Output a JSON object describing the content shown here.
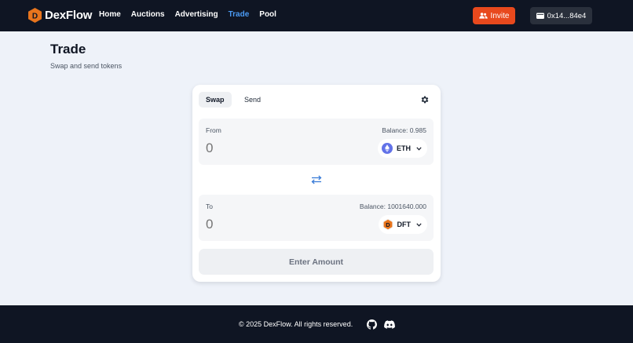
{
  "brand": {
    "name": "DexFlow",
    "logo_letter": "D"
  },
  "nav": {
    "items": [
      {
        "label": "Home",
        "active": false
      },
      {
        "label": "Auctions",
        "active": false
      },
      {
        "label": "Advertising",
        "active": false
      },
      {
        "label": "Trade",
        "active": true
      },
      {
        "label": "Pool",
        "active": false
      }
    ],
    "invite_label": "Invite",
    "wallet_label": "0x14...84e4"
  },
  "page": {
    "title": "Trade",
    "subtitle": "Swap and send tokens"
  },
  "swap": {
    "tabs": [
      {
        "label": "Swap",
        "active": true
      },
      {
        "label": "Send",
        "active": false
      }
    ],
    "from": {
      "label": "From",
      "balance": "Balance: 0.985",
      "amount_placeholder": "0",
      "token": "ETH"
    },
    "to": {
      "label": "To",
      "balance": "Balance: 1001640.000",
      "amount_placeholder": "0",
      "token": "DFT"
    },
    "submit_label": "Enter Amount"
  },
  "footer": {
    "copyright": "© 2025 DexFlow. All rights reserved."
  },
  "colors": {
    "accent": "#4b9bf5",
    "invite": "#e8491d",
    "brand_orange": "#e8751d",
    "dark": "#0f1523",
    "eth": "#6272e8"
  },
  "icons": {
    "logo": "dexflow-logo-icon",
    "invite": "users-icon",
    "wallet": "wallet-icon",
    "settings": "gear-icon",
    "swap_direction": "arrows-swap-icon",
    "chevron": "chevron-down-icon",
    "github": "github-icon",
    "discord": "discord-icon"
  }
}
